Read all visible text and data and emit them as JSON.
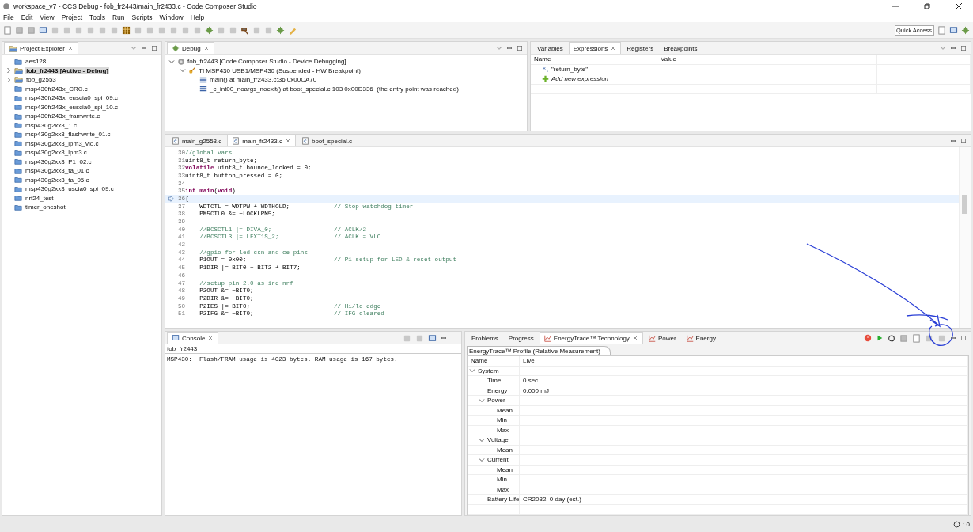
{
  "window": {
    "title": "workspace_v7 - CCS Debug - fob_fr2443/main_fr2433.c - Code Composer Studio"
  },
  "menu": [
    "File",
    "Edit",
    "View",
    "Project",
    "Tools",
    "Run",
    "Scripts",
    "Window",
    "Help"
  ],
  "quick_access": {
    "placeholder": "Quick Access"
  },
  "project_explorer": {
    "title": "Project Explorer",
    "items": [
      {
        "label": "aes128",
        "kind": "folder",
        "expandable": false,
        "selected": false
      },
      {
        "label": "fob_fr2443  [Active - Debug]",
        "kind": "project",
        "expandable": true,
        "selected": true
      },
      {
        "label": "fob_g2553",
        "kind": "project",
        "expandable": true,
        "selected": false
      },
      {
        "label": "msp430fr243x_CRC.c",
        "kind": "folder",
        "expandable": false,
        "selected": false
      },
      {
        "label": "msp430fr243x_euscia0_spi_09.c",
        "kind": "folder",
        "expandable": false,
        "selected": false
      },
      {
        "label": "msp430fr243x_euscia0_spi_10.c",
        "kind": "folder",
        "expandable": false,
        "selected": false
      },
      {
        "label": "msp430fr243x_framwrite.c",
        "kind": "folder",
        "expandable": false,
        "selected": false
      },
      {
        "label": "msp430g2xx3_1.c",
        "kind": "folder",
        "expandable": false,
        "selected": false
      },
      {
        "label": "msp430g2xx3_flashwrite_01.c",
        "kind": "folder",
        "expandable": false,
        "selected": false
      },
      {
        "label": "msp430g2xx3_lpm3_vlo.c",
        "kind": "folder",
        "expandable": false,
        "selected": false
      },
      {
        "label": "msp430g2xx3_lpm3.c",
        "kind": "folder",
        "expandable": false,
        "selected": false
      },
      {
        "label": "msp430g2xx3_P1_02.c",
        "kind": "folder",
        "expandable": false,
        "selected": false
      },
      {
        "label": "msp430g2xx3_ta_01.c",
        "kind": "folder",
        "expandable": false,
        "selected": false
      },
      {
        "label": "msp430g2xx3_ta_05.c",
        "kind": "folder",
        "expandable": false,
        "selected": false
      },
      {
        "label": "msp430g2xx3_uscia0_spi_09.c",
        "kind": "folder",
        "expandable": false,
        "selected": false
      },
      {
        "label": "nrf24_test",
        "kind": "folder",
        "expandable": false,
        "selected": false
      },
      {
        "label": "timer_oneshot",
        "kind": "folder",
        "expandable": false,
        "selected": false
      }
    ]
  },
  "debug": {
    "title": "Debug",
    "tree": [
      {
        "label": "fob_fr2443 [Code Composer Studio - Device Debugging]",
        "kind": "session",
        "expanded": true,
        "children": [
          {
            "label": "TI MSP430 USB1/MSP430 (Suspended - HW Breakpoint)",
            "kind": "target",
            "expanded": true,
            "children": [
              {
                "label": "main() at main_fr2433.c:36 0x00CA70",
                "kind": "frame"
              },
              {
                "label": "_c_int00_noargs_noexit() at boot_special.c:103 0x00D336  (the entry point was reached)",
                "kind": "frame"
              }
            ]
          }
        ]
      }
    ]
  },
  "expressions": {
    "tabs": [
      {
        "label": "Variables",
        "selected": false
      },
      {
        "label": "Expressions",
        "selected": true
      },
      {
        "label": "Registers",
        "selected": false
      },
      {
        "label": "Breakpoints",
        "selected": false
      }
    ],
    "columns": [
      "Name",
      "Value"
    ],
    "rows": [
      {
        "kind": "expression",
        "name": "\"return_byte\""
      },
      {
        "kind": "add",
        "name": "Add new expression"
      }
    ]
  },
  "editor": {
    "tabs": [
      {
        "label": "main_g2553.c",
        "selected": false
      },
      {
        "label": "main_fr2433.c",
        "selected": true
      },
      {
        "label": "boot_special.c",
        "selected": false
      }
    ],
    "lines": [
      {
        "number": "30",
        "kind": "comment",
        "code": "//global vars",
        "current": false
      },
      {
        "number": "31",
        "kind": "code",
        "code": "uint8_t return_byte;",
        "current": false
      },
      {
        "number": "32",
        "kind": "code",
        "code": "**volatile** uint8_t bounce_locked = 0;",
        "current": false
      },
      {
        "number": "33",
        "kind": "code",
        "code": "uint8_t button_pressed = 0;",
        "current": false
      },
      {
        "number": "34",
        "current": false
      },
      {
        "number": "35",
        "kind": "code",
        "code": "**int main**(**void**)",
        "current": false
      },
      {
        "number": "36",
        "kind": "code",
        "code": "{",
        "current": true
      },
      {
        "number": "37",
        "kind": "code",
        "code": "    WDTCTL = WDTPW + WDTHOLD;",
        "comment": "// Stop watchdog timer",
        "current": false
      },
      {
        "number": "38",
        "kind": "code",
        "code": "    PM5CTL0 &= ~LOCKLPM5;",
        "current": false
      },
      {
        "number": "39",
        "current": false
      },
      {
        "number": "40",
        "kind": "comment",
        "code": "    //BCSCTL1 |= DIVA_0;",
        "comment": "// ACLK/2",
        "current": false
      },
      {
        "number": "41",
        "kind": "comment",
        "code": "    //BCSCTL3 |= LFXT1S_2;",
        "comment": "// ACLK = VLO",
        "current": false
      },
      {
        "number": "42",
        "current": false
      },
      {
        "number": "43",
        "kind": "comment",
        "code": "    //gpio for led csn and ce pins",
        "current": false
      },
      {
        "number": "44",
        "kind": "code",
        "code": "    P1OUT = 0x00;",
        "comment": "// P1 setup for LED & reset output",
        "current": false
      },
      {
        "number": "45",
        "kind": "code",
        "code": "    P1DIR |= BIT0 + BIT2 + BIT7;",
        "current": false
      },
      {
        "number": "46",
        "current": false
      },
      {
        "number": "47",
        "kind": "comment",
        "code": "    //setup pin 2.0 as irq nrf",
        "current": false
      },
      {
        "number": "48",
        "kind": "code",
        "code": "    P2OUT &= ~BIT0;",
        "current": false
      },
      {
        "number": "49",
        "kind": "code",
        "code": "    P2DIR &= ~BIT0;",
        "current": false
      },
      {
        "number": "50",
        "kind": "code",
        "code": "    P2IES |= BIT0;",
        "comment": "// Hi/lo edge",
        "current": false
      },
      {
        "number": "51",
        "kind": "code",
        "code": "    P2IFG &= ~BIT0;",
        "comment": "// IFG cleared",
        "current": false
      }
    ]
  },
  "console": {
    "title": "Console",
    "source": "fob_fr2443",
    "lines": [
      "MSP430:  Flash/FRAM usage is 4023 bytes. RAM usage is 167 bytes."
    ]
  },
  "energy": {
    "tabs": [
      {
        "label": "Problems",
        "selected": false
      },
      {
        "label": "Progress",
        "selected": false
      },
      {
        "label": "EnergyTrace™ Technology",
        "selected": true
      },
      {
        "label": "Power",
        "selected": false
      },
      {
        "label": "Energy",
        "selected": false
      }
    ],
    "profile_tab": "EnergyTrace™ Profile (Relative Measurement)",
    "columns": [
      "Name",
      "Live"
    ],
    "rows": [
      {
        "name": "System",
        "expanded": true,
        "children": [
          {
            "name": "Time",
            "value": "0 sec"
          },
          {
            "name": "Energy",
            "value": "0.000 mJ"
          },
          {
            "name": "Power",
            "expanded": true,
            "children": [
              {
                "name": "Mean"
              },
              {
                "name": "Min"
              },
              {
                "name": "Max"
              }
            ]
          },
          {
            "name": "Voltage",
            "expanded": true,
            "children": [
              {
                "name": "Mean"
              }
            ]
          },
          {
            "name": "Current",
            "expanded": true,
            "children": [
              {
                "name": "Mean"
              },
              {
                "name": "Min"
              },
              {
                "name": "Max"
              }
            ]
          },
          {
            "name": "Battery Life",
            "value": "CR2032: 0 day (est.)"
          }
        ]
      }
    ]
  },
  "status_bar": {
    "count": ": 0"
  },
  "annotation": {
    "kind": "arrow-circle"
  }
}
